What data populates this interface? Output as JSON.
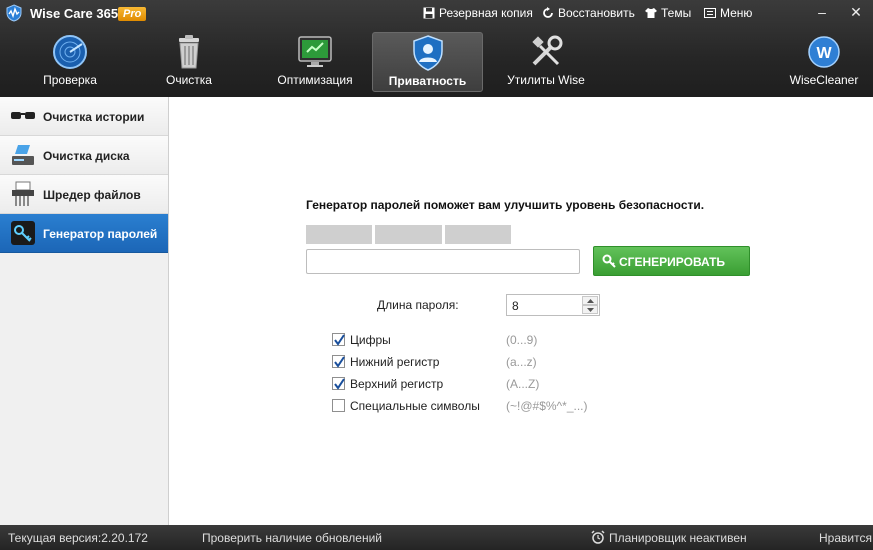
{
  "app": {
    "title": "Wise Care 365",
    "badge": "Pro"
  },
  "top_menu": {
    "backup": "Резервная копия",
    "restore": "Восстановить",
    "themes": "Темы",
    "menu": "Меню"
  },
  "nav": {
    "tabs": [
      {
        "label": "Проверка",
        "icon": "radar-icon"
      },
      {
        "label": "Очистка",
        "icon": "trash-can-icon"
      },
      {
        "label": "Оптимизация",
        "icon": "monitor-optimize-icon"
      },
      {
        "label": "Приватность",
        "icon": "shield-user-icon",
        "active": true
      },
      {
        "label": "Утилиты Wise",
        "icon": "tools-icon"
      }
    ],
    "brand": "WiseCleaner"
  },
  "sidebar": {
    "items": [
      {
        "label": "Очистка истории",
        "icon": "glasses-icon"
      },
      {
        "label": "Очистка диска",
        "icon": "disk-eraser-icon"
      },
      {
        "label": "Шредер файлов",
        "icon": "shredder-icon"
      },
      {
        "label": "Генератор паролей",
        "icon": "key-icon",
        "active": true
      }
    ]
  },
  "generator": {
    "headline": "Генератор паролей поможет вам улучшить уровень безопасности.",
    "password_value": "",
    "button_label": "СГЕНЕРИРОВАТЬ",
    "length_label": "Длина пароля:",
    "length_value": "8",
    "options": [
      {
        "label": "Цифры",
        "hint": "(0...9)",
        "checked": true
      },
      {
        "label": "Нижний регистр",
        "hint": "(a...z)",
        "checked": true
      },
      {
        "label": "Верхний регистр",
        "hint": "(A...Z)",
        "checked": true
      },
      {
        "label": "Специальные символы",
        "hint": "(~!@#$%^*_...)",
        "checked": false
      }
    ]
  },
  "status": {
    "version": "Текущая версия:2.20.172",
    "check_updates": "Проверить наличие обновлений",
    "scheduler": "Планировщик неактивен",
    "like": "Нравится"
  },
  "colors": {
    "accent_blue": "#1f6fc2",
    "button_green": "#4caf44",
    "toolbar_dark": "#2a2a2a"
  }
}
